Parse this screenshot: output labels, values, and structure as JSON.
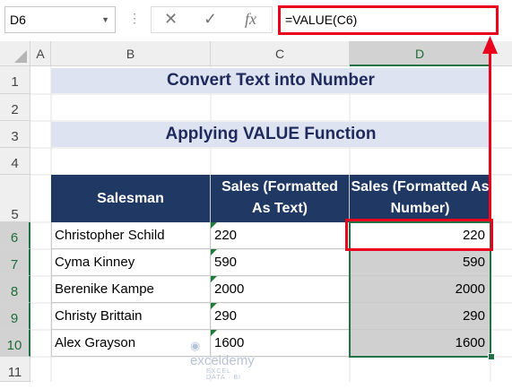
{
  "formula_bar": {
    "name_box": "D6",
    "formula": "=VALUE(C6)",
    "cancel_icon": "x-icon",
    "enter_icon": "check-icon",
    "fx_label": "fx"
  },
  "columns": [
    "A",
    "B",
    "C",
    "D"
  ],
  "rows": [
    "1",
    "2",
    "3",
    "4",
    "5",
    "6",
    "7",
    "8",
    "9",
    "10",
    "11"
  ],
  "sheet": {
    "title": "Convert Text into Number",
    "subtitle": "Applying VALUE Function",
    "headers": [
      "Salesman",
      "Sales (Formatted As Text)",
      "Sales (Formatted As Number)"
    ],
    "data": [
      {
        "name": "Christopher Schild",
        "text": "220",
        "number": "220"
      },
      {
        "name": "Cyma Kinney",
        "text": "590",
        "number": "590"
      },
      {
        "name": "Berenike Kampe",
        "text": "2000",
        "number": "2000"
      },
      {
        "name": "Christy Brittain",
        "text": "290",
        "number": "290"
      },
      {
        "name": "Alex Grayson",
        "text": "1600",
        "number": "1600"
      }
    ]
  },
  "watermark": {
    "brand": "exceldemy",
    "tagline": "EXCEL · DATA · BI"
  },
  "colors": {
    "accent_red": "#e8001c",
    "header_navy": "#203864",
    "title_fill": "#dde3f0",
    "select_green": "#217346"
  }
}
